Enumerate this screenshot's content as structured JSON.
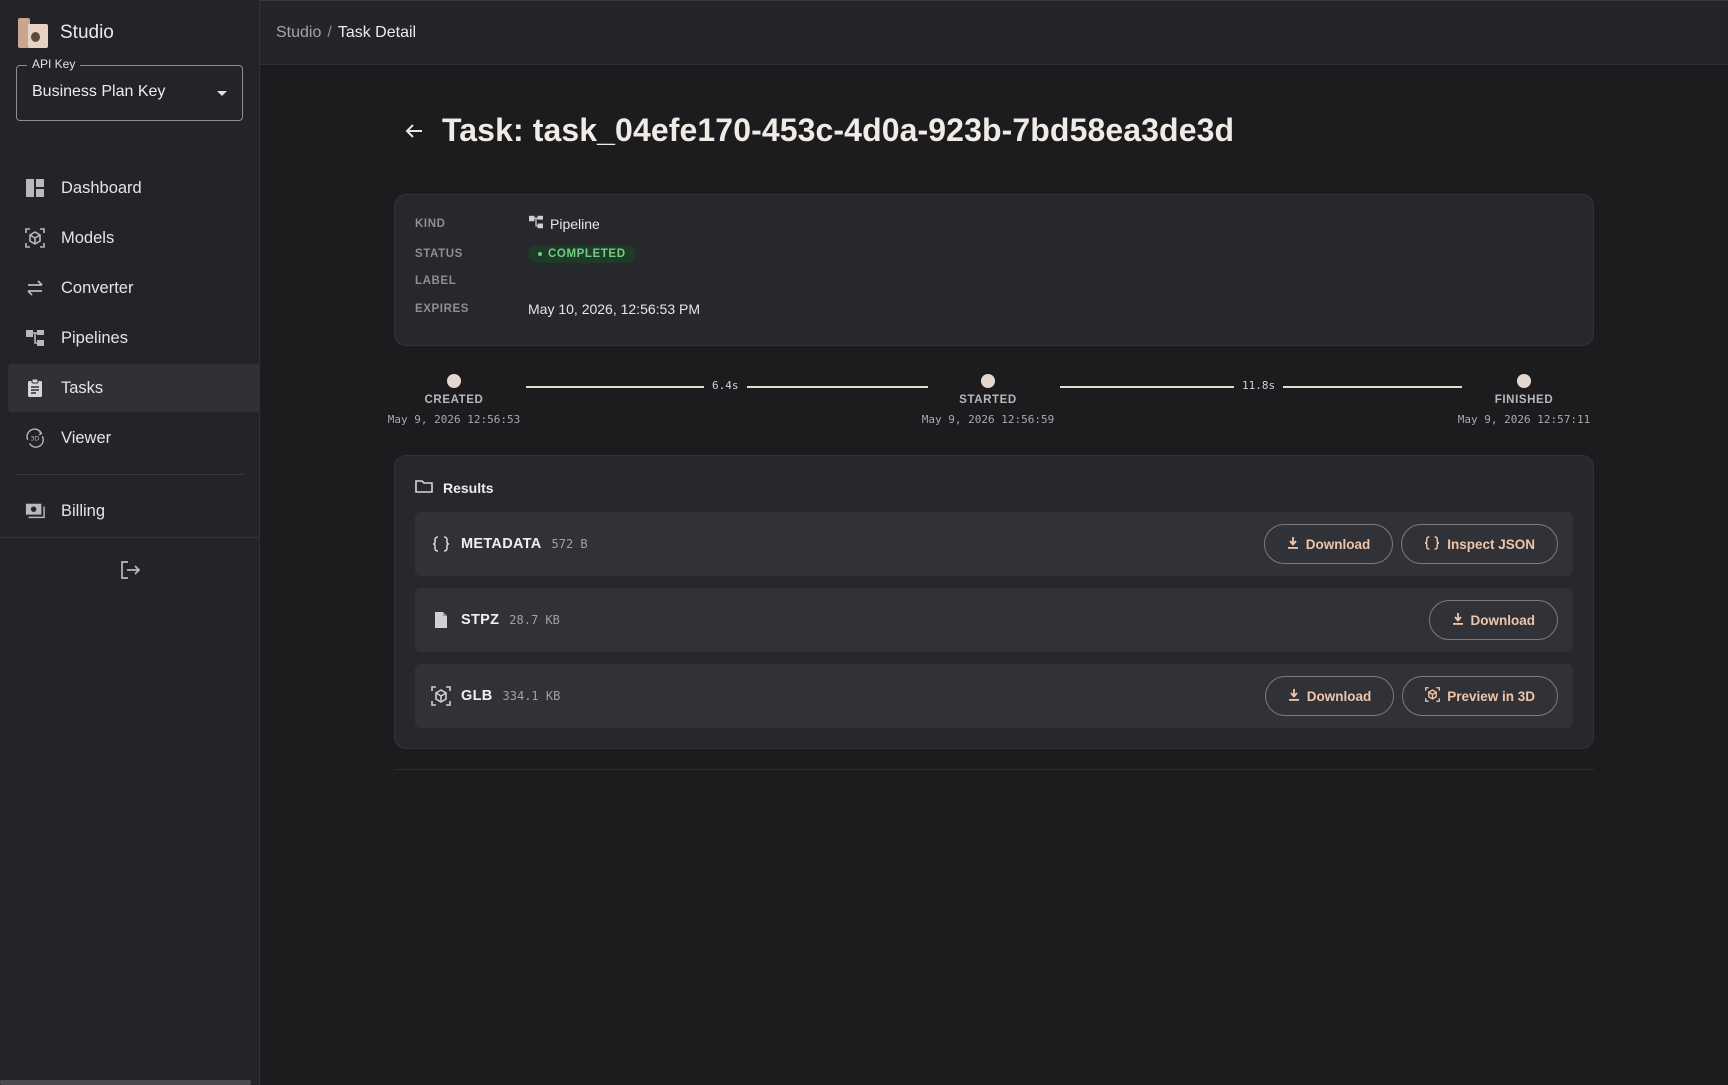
{
  "app": {
    "name": "Studio"
  },
  "api_key": {
    "legend": "API Key",
    "value": "Business Plan Key"
  },
  "nav": {
    "items": [
      {
        "label": "Dashboard",
        "icon": "dashboard-icon"
      },
      {
        "label": "Models",
        "icon": "cube-icon"
      },
      {
        "label": "Converter",
        "icon": "swap-icon"
      },
      {
        "label": "Pipelines",
        "icon": "pipeline-icon"
      },
      {
        "label": "Tasks",
        "icon": "clipboard-icon",
        "active": true
      },
      {
        "label": "Viewer",
        "icon": "viewer-3d-icon"
      }
    ],
    "billing": {
      "label": "Billing",
      "icon": "billing-icon"
    }
  },
  "breadcrumb": {
    "root": "Studio",
    "separator": "/",
    "current": "Task Detail"
  },
  "task": {
    "title": "Task: task_04efe170-453c-4d0a-923b-7bd58ea3de3d",
    "fields": {
      "kind_label": "KIND",
      "kind_value": "Pipeline",
      "status_label": "STATUS",
      "status_value": "COMPLETED",
      "label_label": "LABEL",
      "label_value": "",
      "expires_label": "EXPIRES",
      "expires_value": "May 10, 2026, 12:56:53 PM"
    }
  },
  "timeline": {
    "created": {
      "label": "CREATED",
      "time": "May 9, 2026 12:56:53"
    },
    "started": {
      "label": "STARTED",
      "time": "May 9, 2026 12:56:59"
    },
    "finished": {
      "label": "FINISHED",
      "time": "May 9, 2026 12:57:11"
    },
    "durations": [
      "6.4s",
      "11.8s"
    ]
  },
  "results": {
    "title": "Results",
    "items": [
      {
        "name": "METADATA",
        "size": "572 B",
        "icon": "braces-icon",
        "actions": [
          "Download",
          "Inspect JSON"
        ]
      },
      {
        "name": "STPZ",
        "size": "28.7 KB",
        "icon": "file-icon",
        "actions": [
          "Download"
        ]
      },
      {
        "name": "GLB",
        "size": "334.1 KB",
        "icon": "cube-icon",
        "actions": [
          "Download",
          "Preview in 3D"
        ]
      }
    ]
  },
  "colors": {
    "accent": "#efc5aa",
    "status_success": "#6fcf82",
    "background": "#1c1c1f",
    "sidebar": "#232428"
  }
}
